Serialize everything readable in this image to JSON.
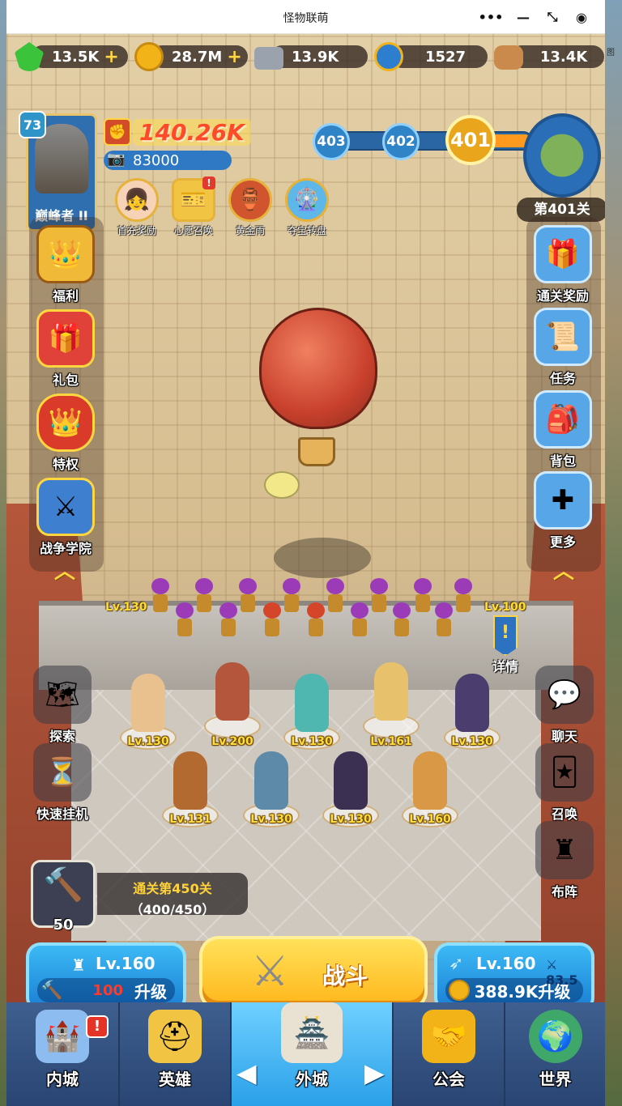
{
  "window": {
    "title": "怪物联萌",
    "controls": [
      "more-icon",
      "minimize-icon",
      "compact-icon",
      "record-icon"
    ]
  },
  "resources": [
    {
      "name": "gem",
      "value": "13.5K",
      "has_plus": true,
      "color": "#3cc33c"
    },
    {
      "name": "gold",
      "value": "28.7M",
      "has_plus": true,
      "color": "#f2b318"
    },
    {
      "name": "iron",
      "value": "13.9K",
      "has_plus": false,
      "color": "#9aa3ad"
    },
    {
      "name": "medal",
      "value": "1527",
      "has_plus": false,
      "color": "#2e7ed0"
    },
    {
      "name": "wood",
      "value": "13.4K",
      "has_plus": false,
      "color": "#c98a4b"
    }
  ],
  "resource_plus": "+",
  "edge_glyph": "图",
  "player": {
    "level": "73",
    "rank": "巅峰者 II",
    "power": "140.26K",
    "camera_value": "83000"
  },
  "events": [
    {
      "label": "首充奖励",
      "icon": "girl-icon",
      "alert": false
    },
    {
      "label": "心愿召唤",
      "icon": "ticket-icon",
      "alert": true
    },
    {
      "label": "黄金雨",
      "icon": "pot-icon",
      "alert": false
    },
    {
      "label": "夺宝转盘",
      "icon": "wheel-icon",
      "alert": false
    }
  ],
  "alert_mark": "!",
  "stage_progress": {
    "nodes": [
      "403",
      "402",
      "401"
    ],
    "current": "401",
    "map_label": "第401关"
  },
  "left_menu": [
    {
      "label": "福利",
      "icon": "crown-badge-icon"
    },
    {
      "label": "礼包",
      "icon": "gift-icon"
    },
    {
      "label": "特权",
      "icon": "crown-shield-icon"
    },
    {
      "label": "战争学院",
      "icon": "crossed-swords-icon"
    }
  ],
  "right_menu": [
    {
      "label": "通关奖励",
      "icon": "giftbox-icon"
    },
    {
      "label": "任务",
      "icon": "scroll-icon"
    },
    {
      "label": "背包",
      "icon": "backpack-icon"
    },
    {
      "label": "更多",
      "icon": "dpad-icon"
    }
  ],
  "towers": {
    "left_level": "Lv.130",
    "right_level": "Lv.100"
  },
  "detail_label": "详情",
  "side_lower_left": [
    {
      "label": "探索",
      "icon": "map-sword-icon"
    },
    {
      "label": "快速挂机",
      "icon": "hourglass-icon"
    }
  ],
  "side_lower_right": [
    {
      "label": "聊天",
      "icon": "chat-icon"
    },
    {
      "label": "召唤",
      "icon": "cards-icon"
    },
    {
      "label": "布阵",
      "icon": "chess-rook-icon"
    }
  ],
  "heroes_row1": [
    {
      "level": "Lv.130",
      "color": "#e8c18f"
    },
    {
      "level": "Lv.200",
      "color": "#b4563b"
    },
    {
      "level": "Lv.130",
      "color": "#4fb7b0"
    },
    {
      "level": "Lv.161",
      "color": "#e7c16b"
    },
    {
      "level": "Lv.130",
      "color": "#4b3e6e"
    }
  ],
  "heroes_row2": [
    {
      "level": "Lv.131",
      "color": "#b26a30"
    },
    {
      "level": "Lv.130",
      "color": "#5d8aa8"
    },
    {
      "level": "Lv.130",
      "color": "#3b2f52"
    },
    {
      "level": "Lv.160",
      "color": "#d99845"
    }
  ],
  "stage_info": {
    "clear_text": "通关第450关",
    "progress_text": "（400/450）",
    "hammer_count": "50",
    "progress_fraction": 0.889
  },
  "upgrade_left": {
    "level": "Lv.160",
    "cost": "100",
    "action": "升级"
  },
  "fight": {
    "label": "战斗"
  },
  "upgrade_right": {
    "level": "Lv.160",
    "attack": "83.5",
    "cost_action": "388.9K升级"
  },
  "nav": [
    {
      "label": "内城",
      "icon": "castle-icon",
      "alert": true
    },
    {
      "label": "英雄",
      "icon": "helmet-icon",
      "alert": false
    },
    {
      "label": "外城",
      "icon": "fortress-icon",
      "alert": false,
      "active": true
    },
    {
      "label": "公会",
      "icon": "handshake-icon",
      "alert": false
    },
    {
      "label": "世界",
      "icon": "globe-icon",
      "alert": false
    }
  ],
  "nav_arrows": {
    "left": "◀",
    "right": "▶"
  }
}
